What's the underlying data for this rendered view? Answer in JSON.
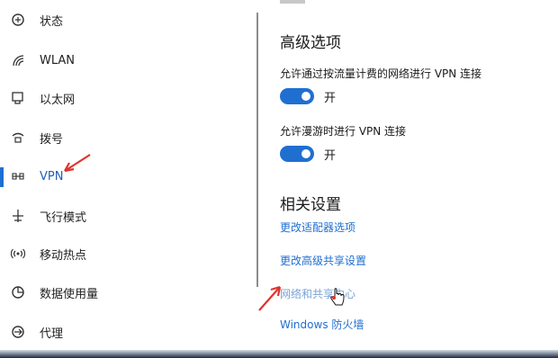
{
  "sidebar": {
    "items": [
      {
        "label": "状态",
        "icon": "status-icon"
      },
      {
        "label": "WLAN",
        "icon": "wifi-icon"
      },
      {
        "label": "以太网",
        "icon": "ethernet-icon"
      },
      {
        "label": "拨号",
        "icon": "dial-up-icon"
      },
      {
        "label": "VPN",
        "icon": "vpn-icon",
        "active": true
      },
      {
        "label": "飞行模式",
        "icon": "airplane-icon"
      },
      {
        "label": "移动热点",
        "icon": "hotspot-icon"
      },
      {
        "label": "数据使用量",
        "icon": "data-usage-icon"
      },
      {
        "label": "代理",
        "icon": "proxy-icon"
      }
    ]
  },
  "advanced": {
    "title": "高级选项",
    "metered_label": "允许通过按流量计费的网络进行 VPN 连接",
    "metered_state": "开",
    "roaming_label": "允许漫游时进行 VPN 连接",
    "roaming_state": "开"
  },
  "related": {
    "title": "相关设置",
    "links": [
      "更改适配器选项",
      "更改高级共享设置",
      "网络和共享中心",
      "Windows 防火墙"
    ]
  },
  "colors": {
    "accent": "#1f6fd1",
    "annotation": "#e0332c"
  }
}
